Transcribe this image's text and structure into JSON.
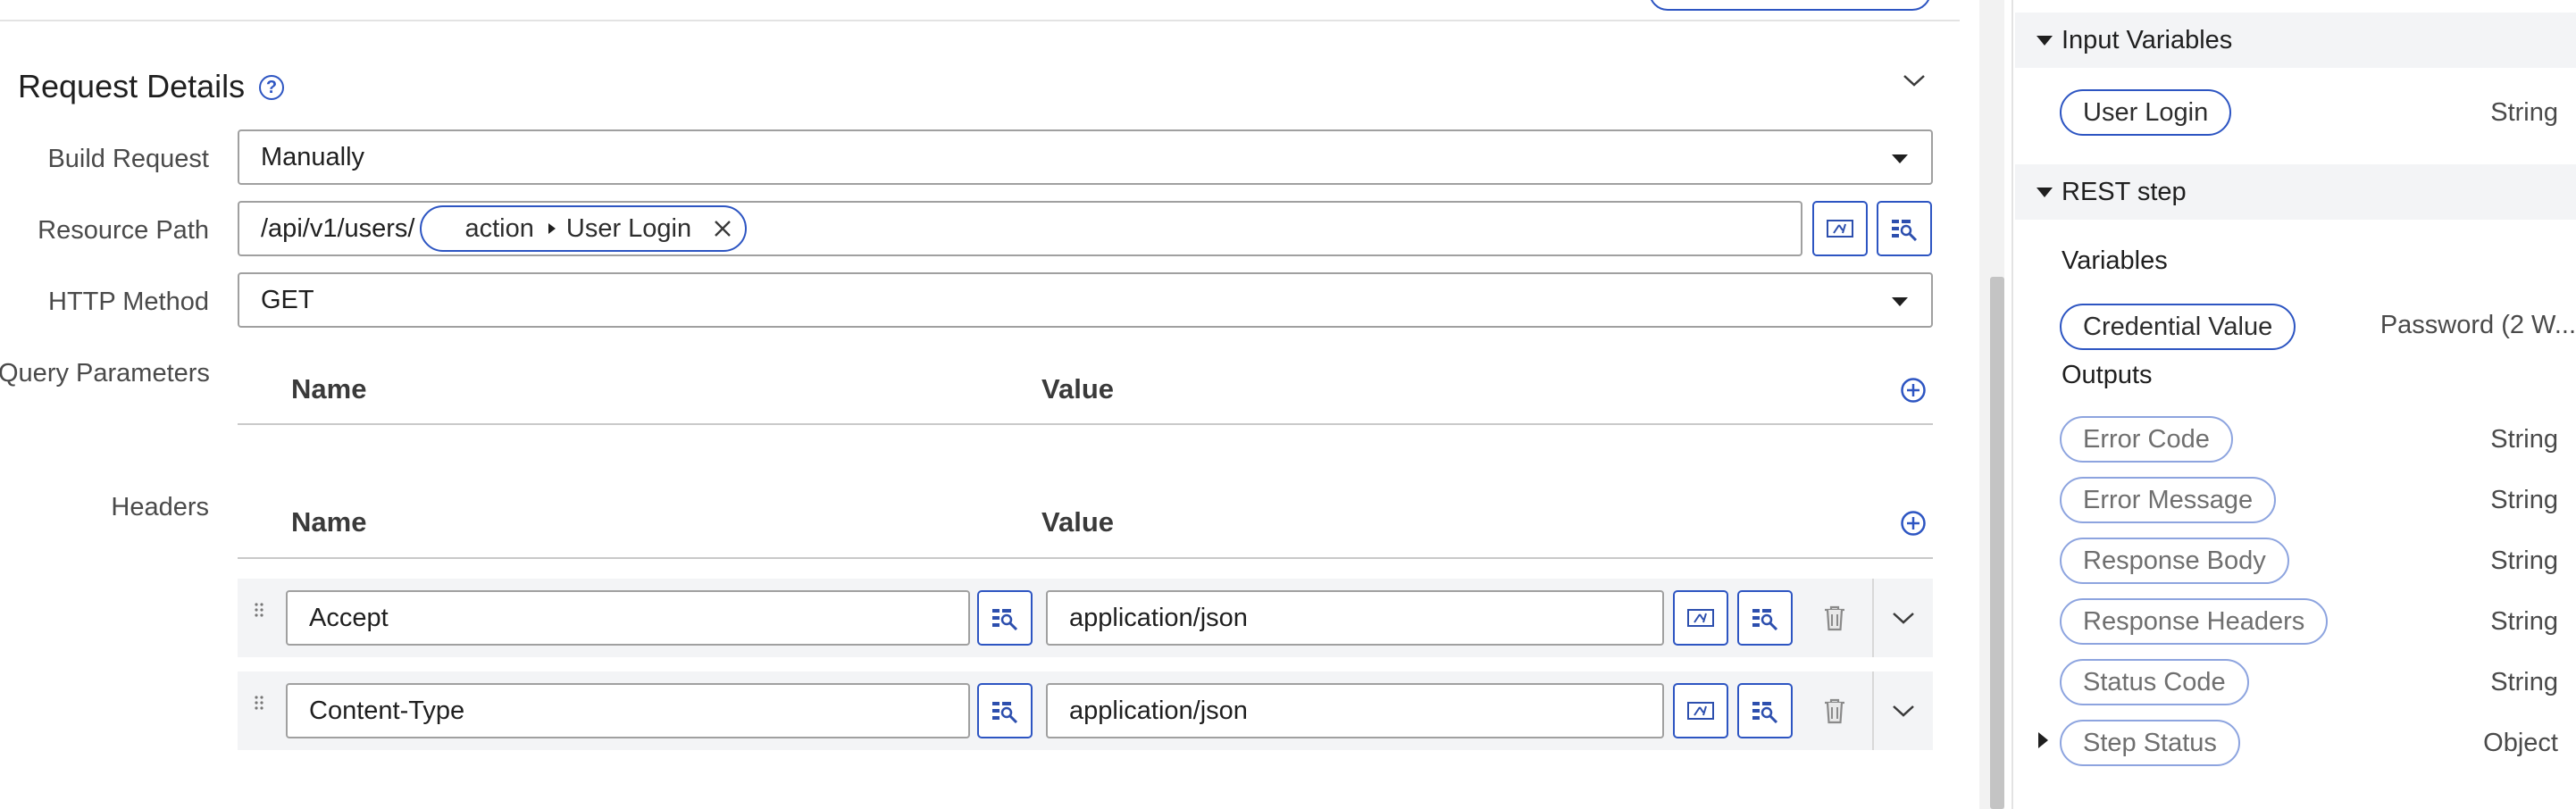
{
  "request_details": {
    "title": "Request Details",
    "help_icon": "question-circle-icon",
    "build_request": {
      "label": "Build Request",
      "value": "Manually"
    },
    "resource_path": {
      "label": "Resource Path",
      "prefix": "/api/v1/users/",
      "pill": {
        "scope": "action",
        "name": "User Login"
      }
    },
    "http_method": {
      "label": "HTTP Method",
      "value": "GET"
    },
    "query_parameters": {
      "label": "Query Parameters",
      "name_header": "Name",
      "value_header": "Value"
    },
    "headers": {
      "label": "Headers",
      "name_header": "Name",
      "value_header": "Value",
      "rows": [
        {
          "name": "Accept",
          "value": "application/json"
        },
        {
          "name": "Content-Type",
          "value": "application/json"
        }
      ]
    }
  },
  "side_panel": {
    "input_variables": {
      "title": "Input Variables",
      "items": [
        {
          "name": "User Login",
          "type": "String"
        }
      ]
    },
    "rest_step": {
      "title": "REST step",
      "variables_label": "Variables",
      "variables": [
        {
          "name": "Credential Value",
          "type": "Password (2 W..."
        }
      ],
      "outputs_label": "Outputs",
      "outputs": [
        {
          "name": "Error Code",
          "type": "String"
        },
        {
          "name": "Error Message",
          "type": "String"
        },
        {
          "name": "Response Body",
          "type": "String"
        },
        {
          "name": "Response Headers",
          "type": "String"
        },
        {
          "name": "Status Code",
          "type": "String"
        },
        {
          "name": "Step Status",
          "type": "Object"
        }
      ]
    }
  },
  "colors": {
    "accent": "#2d55c2",
    "border": "#a0a0a0",
    "panel_bg": "#f3f4f6"
  }
}
